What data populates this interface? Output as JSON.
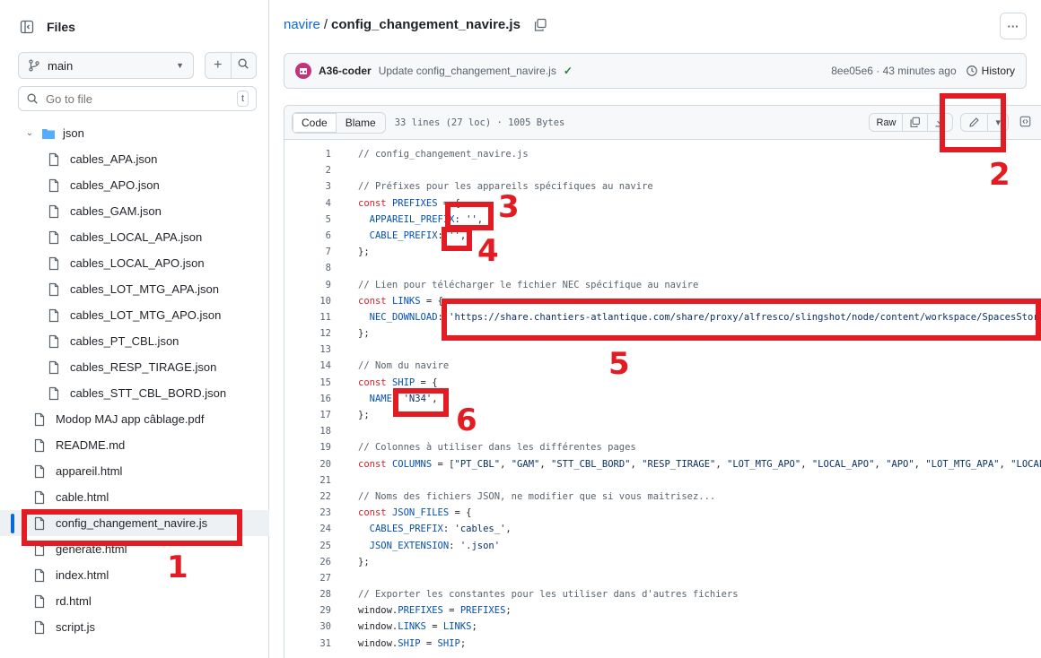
{
  "sidebar": {
    "title": "Files",
    "branch": "main",
    "search_placeholder": "Go to file",
    "search_shortcut": "t",
    "folder": "json",
    "json_files": [
      "cables_APA.json",
      "cables_APO.json",
      "cables_GAM.json",
      "cables_LOCAL_APA.json",
      "cables_LOCAL_APO.json",
      "cables_LOT_MTG_APA.json",
      "cables_LOT_MTG_APO.json",
      "cables_PT_CBL.json",
      "cables_RESP_TIRAGE.json",
      "cables_STT_CBL_BORD.json"
    ],
    "root_files": [
      "Modop MAJ app câblage.pdf",
      "README.md",
      "appareil.html",
      "cable.html",
      "config_changement_navire.js",
      "generate.html",
      "index.html",
      "rd.html",
      "script.js"
    ],
    "selected_file": "config_changement_navire.js"
  },
  "breadcrumb": {
    "repo": "navire",
    "separator": "/",
    "file": "config_changement_navire.js"
  },
  "commit": {
    "author": "A36-coder",
    "message": "Update config_changement_navire.js",
    "hash_time": "8ee05e6 · 43 minutes ago",
    "history_label": "History"
  },
  "file_header": {
    "tab_code": "Code",
    "tab_blame": "Blame",
    "info": "33 lines (27 loc) · 1005 Bytes",
    "raw_label": "Raw"
  },
  "code_lines": [
    "// config_changement_navire.js",
    "",
    "// Préfixes pour les appareils spécifiques au navire",
    "const PREFIXES = {",
    "  APPAREIL_PREFIX: '',",
    "  CABLE_PREFIX: '',",
    "};",
    "",
    "// Lien pour télécharger le fichier NEC spécifique au navire",
    "const LINKS = {",
    "  NEC_DOWNLOAD: 'https://share.chantiers-atlantique.com/share/proxy/alfresco/slingshot/node/content/workspace/SpacesStore",
    "};",
    "",
    "// Nom du navire",
    "const SHIP = {",
    "  NAME: 'N34',",
    "};",
    "",
    "// Colonnes à utiliser dans les différentes pages",
    "const COLUMNS = [\"PT_CBL\", \"GAM\", \"STT_CBL_BORD\", \"RESP_TIRAGE\", \"LOT_MTG_APO\", \"LOCAL_APO\", \"APO\", \"LOT_MTG_APA\", \"LOCAL_APA\"",
    "",
    "// Noms des fichiers JSON, ne modifier que si vous maitrisez...",
    "const JSON_FILES = {",
    "  CABLES_PREFIX: 'cables_',",
    "  JSON_EXTENSION: '.json'",
    "};",
    "",
    "// Exporter les constantes pour les utiliser dans d'autres fichiers",
    "window.PREFIXES = PREFIXES;",
    "window.LINKS = LINKS;",
    "window.SHIP = SHIP;"
  ],
  "annotations": [
    "1",
    "2",
    "3",
    "4",
    "5",
    "6"
  ],
  "colors": {
    "annotation": "#e31b23",
    "link": "#0969da",
    "keyword": "#cf222e",
    "string": "#0a3069"
  }
}
